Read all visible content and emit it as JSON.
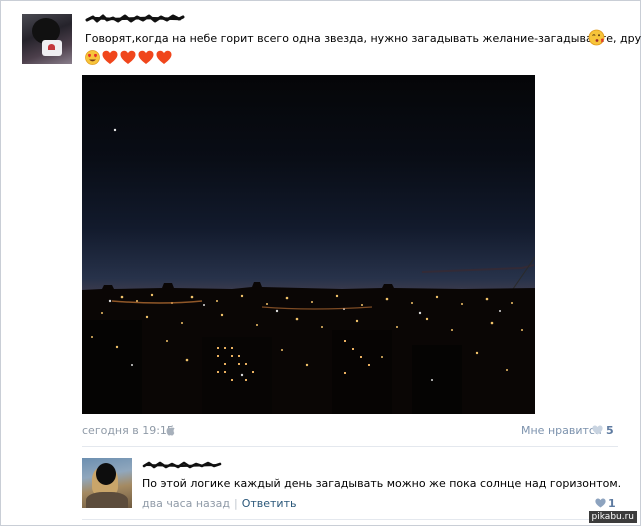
{
  "post": {
    "text": "Говорят,когда на небе горит всего одна звезда, нужно загадывать желание-загадывайте, друзья!!!",
    "emoji_after_text": "winking-kiss-emoji",
    "emoji_row": [
      "heart-eyes-emoji",
      "orange-heart-emoji",
      "orange-heart-emoji",
      "orange-heart-emoji",
      "orange-heart-emoji"
    ],
    "date": "сегодня в 19:15",
    "platform_icon": "apple-icon",
    "like_label": "Мне нравится",
    "like_count": "5"
  },
  "comment": {
    "text": "По этой логике каждый день загадывать можно же пока солнце над горизонтом.",
    "time": "два часа назад",
    "separator": "|",
    "reply_label": "Ответить",
    "like_count": "1"
  },
  "watermark": "pikabu.ru",
  "colors": {
    "link": "#2b587a",
    "meta": "#8f9aa7",
    "like_blue": "#5d7aa0",
    "heart_orange": "#f0461c"
  }
}
